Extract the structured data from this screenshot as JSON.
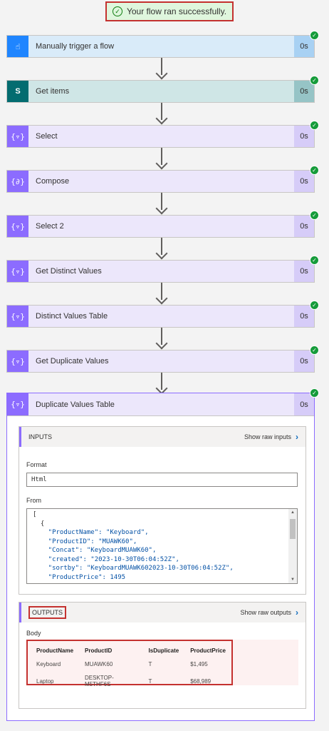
{
  "banner": {
    "text": "Your flow ran successfully."
  },
  "steps": [
    {
      "title": "Manually trigger a flow",
      "duration": "0s",
      "icon": "touch-icon",
      "glyph": "☝"
    },
    {
      "title": "Get items",
      "duration": "0s",
      "icon": "sharepoint-icon",
      "glyph": "S"
    },
    {
      "title": "Select",
      "duration": "0s",
      "icon": "data-operation-icon",
      "glyph": "{▿}"
    },
    {
      "title": "Compose",
      "duration": "0s",
      "icon": "data-operation-icon",
      "glyph": "{∂}"
    },
    {
      "title": "Select 2",
      "duration": "0s",
      "icon": "data-operation-icon",
      "glyph": "{▿}"
    },
    {
      "title": "Get Distinct Values",
      "duration": "0s",
      "icon": "data-operation-icon",
      "glyph": "{▿}"
    },
    {
      "title": "Distinct Values Table",
      "duration": "0s",
      "icon": "data-operation-icon",
      "glyph": "{▿}"
    },
    {
      "title": "Get Duplicate Values",
      "duration": "0s",
      "icon": "data-operation-icon",
      "glyph": "{▿}"
    }
  ],
  "expanded": {
    "title": "Duplicate Values Table",
    "duration": "0s",
    "glyph": "{▿}",
    "inputs": {
      "header": "INPUTS",
      "raw_label": "Show raw inputs",
      "format_label": "Format",
      "format_value": "Html",
      "from_label": "From",
      "code": [
        "[",
        "  {",
        "    \"ProductName\": \"Keyboard\",",
        "    \"ProductID\": \"MUAWK60\",",
        "    \"Concat\": \"KeyboardMUAWK60\",",
        "    \"created\": \"2023-10-30T06:04:52Z\",",
        "    \"sortby\": \"KeyboardMUAWK602023-10-30T06:04:52Z\",",
        "    \"ProductPrice\": 1495"
      ]
    },
    "outputs": {
      "header": "OUTPUTS",
      "raw_label": "Show raw outputs",
      "body_label": "Body",
      "columns": [
        "ProductName",
        "ProductID",
        "IsDuplicate",
        "ProductPrice"
      ],
      "rows": [
        [
          "Keyboard",
          "MUAWK60",
          "T",
          "$1,495"
        ],
        [
          "Laptop",
          "DESKTOP-M5THF6S",
          "T",
          "$68,989"
        ]
      ]
    }
  }
}
